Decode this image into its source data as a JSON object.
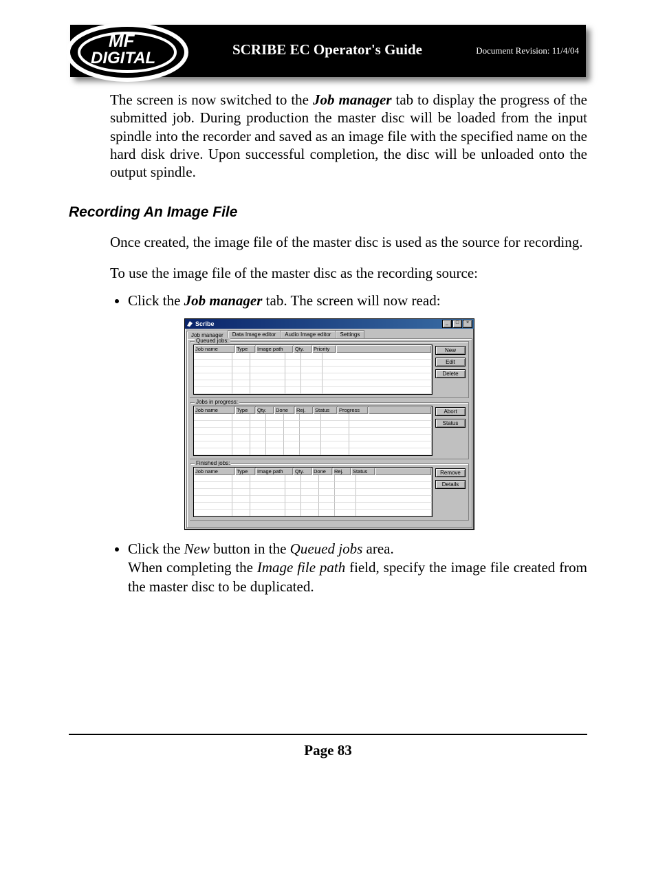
{
  "header": {
    "title": "SCRIBE EC Operator's Guide",
    "revision": "Document Revision: 11/4/04"
  },
  "para1": "The screen is now switched to the Job manager tab to display the progress of the submitted job. During production the master disc will be loaded from the input spindle into the recorder and saved as an image file with the specified name on the hard disk drive. Upon successful completion, the disc will be unloaded onto the output spindle.",
  "section_heading": "Recording An Image File",
  "para2": "Once created, the image file of the master disc is used as the source for recording.",
  "para3": "To use the image file of the master disc as the recording source:",
  "bullet1_pre": "Click the ",
  "bullet1_bold": "Job manager",
  "bullet1_post": "  tab. The screen will now read:",
  "app": {
    "title": "Scribe",
    "tabs": [
      "Job manager",
      "Data Image editor",
      "Audio Image editor",
      "Settings"
    ],
    "groups": {
      "queued": {
        "label": "Queued jobs:",
        "columns": [
          "Job name",
          "Type",
          "Image path",
          "Qty.",
          "Priority"
        ],
        "side": [
          "New",
          "Edit",
          "Delete"
        ]
      },
      "progress": {
        "label": "Jobs in progress:",
        "columns": [
          "Job name",
          "Type",
          "Qty.",
          "Done",
          "Rej.",
          "Status",
          "Progress"
        ],
        "side": [
          "Abort",
          "Status"
        ]
      },
      "finished": {
        "label": "Finished jobs:",
        "columns": [
          "Job name",
          "Type",
          "Image path",
          "Qty.",
          "Done",
          "Rej.",
          "Status"
        ],
        "side": [
          "Remove",
          "Details"
        ]
      }
    }
  },
  "bullet2_line1_pre": "Click the ",
  "bullet2_line1_i1": "New",
  "bullet2_line1_mid": " button in the ",
  "bullet2_line1_i2": "Queued jobs",
  "bullet2_line1_post": " area.",
  "bullet2_line2_pre": "When completing the ",
  "bullet2_line2_i": "Image file path",
  "bullet2_line2_post": " field, specify the image file created from the master disc to be duplicated.",
  "page_number": "Page 83"
}
